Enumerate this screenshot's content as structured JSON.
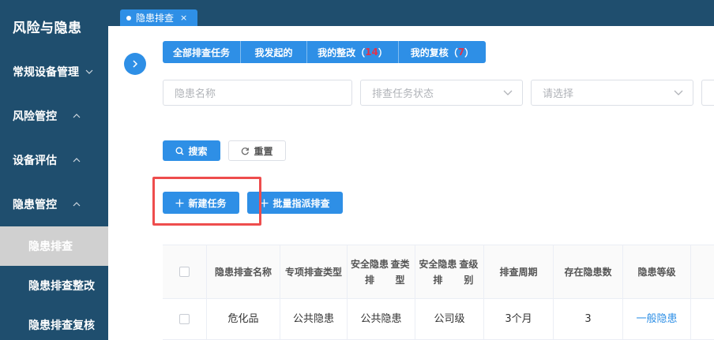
{
  "sidebar": {
    "title": "风险与隐患",
    "menu": [
      {
        "label": "常规设备管理",
        "arrow": "down"
      },
      {
        "label": "风险管控",
        "arrow": "up"
      },
      {
        "label": "设备评估",
        "arrow": "up"
      },
      {
        "label": "隐患管控",
        "arrow": "up"
      }
    ],
    "submenu": [
      {
        "label": "隐患排查",
        "active": true
      },
      {
        "label": "隐患排查整改",
        "active": false
      },
      {
        "label": "隐患排查复核",
        "active": false
      }
    ]
  },
  "tabs": [
    {
      "label": "隐患排查",
      "close": "×"
    }
  ],
  "filter_tabs": [
    {
      "label": "全部排查任务",
      "count": ""
    },
    {
      "label": "我发起的",
      "count": ""
    },
    {
      "label": "我的整改（",
      "count": "14",
      "suffix": "）"
    },
    {
      "label": "我的复核（",
      "count": "7",
      "suffix": "）"
    }
  ],
  "search": {
    "name_placeholder": "隐患名称",
    "status_placeholder": "排查任务状态",
    "select_placeholder": "请选择",
    "search_label": "搜索",
    "reset_label": "重置"
  },
  "actions": {
    "new_task": "新建任务",
    "batch_assign": "批量指派排查"
  },
  "table": {
    "headers": [
      "隐患排查名称",
      "专项排查类型",
      "安全隐患排查类型",
      "安全隐患排查级别",
      "排查周期",
      "存在隐患数",
      "隐患等级"
    ],
    "header_lines": [
      [
        "隐患排查名",
        "称"
      ],
      [
        "专项排查类",
        "型"
      ],
      [
        "安全隐患排",
        "查类型"
      ],
      [
        "安全隐患排",
        "查级别"
      ],
      [
        "排查周期"
      ],
      [
        "存在隐患数"
      ],
      [
        "隐患等级"
      ]
    ],
    "rows": [
      [
        "危化品",
        "公共隐患",
        "公共隐患",
        "公司级",
        "3个月",
        "3",
        "一般隐患"
      ]
    ]
  },
  "colors": {
    "primary": "#2e8fe6",
    "sidebar": "#1f4e6e",
    "highlight": "#ee4d4d",
    "count": "#e0334c"
  }
}
